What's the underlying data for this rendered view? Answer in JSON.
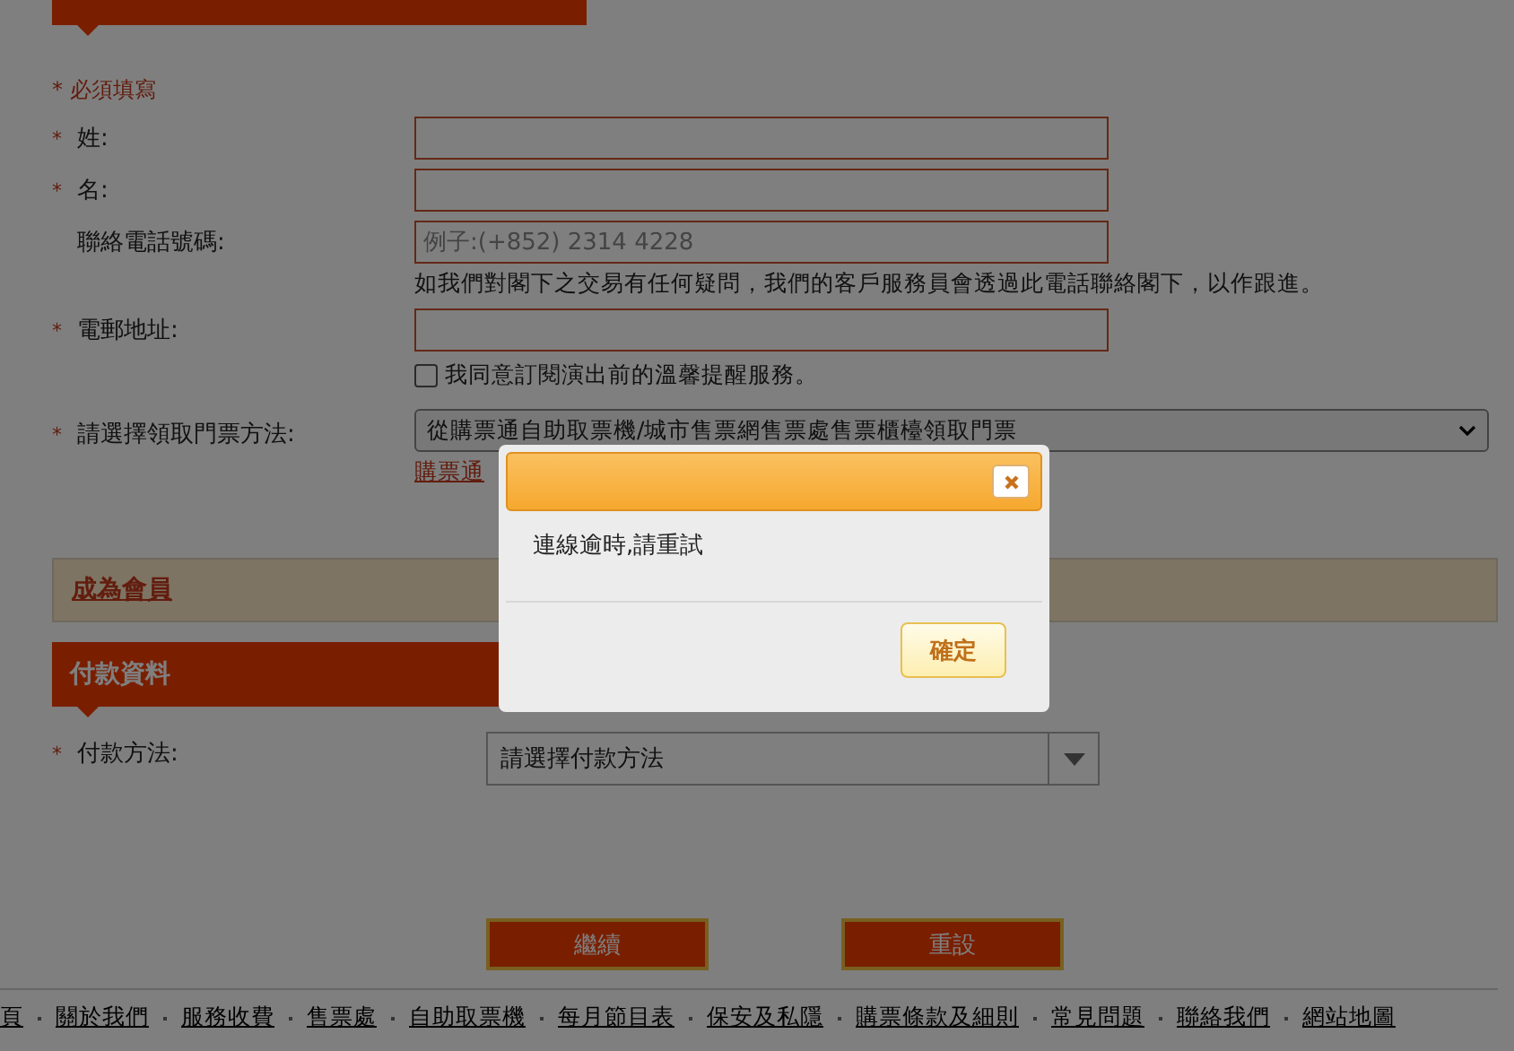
{
  "personal_section": {
    "required_note": "* 必須填寫",
    "fields": [
      {
        "kind": "text",
        "star": "*",
        "label": "姓:"
      },
      {
        "kind": "text",
        "star": "*",
        "label": "名:"
      },
      {
        "kind": "text",
        "label": "聯絡電話號碼:",
        "placeholder": "例子:(+852) 2314 4228",
        "hint": "如我們對閣下之交易有任何疑問，我們的客戶服務員會透過此電話聯絡閣下，以作跟進。"
      },
      {
        "kind": "text",
        "star": "*",
        "label": "電郵地址:"
      },
      {
        "kind": "checkbox",
        "checked": false,
        "label": "我同意訂閱演出前的溫馨提醒服務。"
      },
      {
        "kind": "select",
        "star": "*",
        "label": "請選擇領取門票方法:",
        "value": "從購票通自助取票機/城市售票網售票處售票櫃檯領取門票",
        "link": "購票通"
      }
    ]
  },
  "member_band": {
    "link": "成為會員"
  },
  "payment_section": {
    "title": "付款資料",
    "fields": [
      {
        "kind": "combo",
        "star": "*",
        "label": "付款方法:",
        "value": "請選擇付款方法"
      }
    ]
  },
  "buttons": [
    {
      "label": "繼續"
    },
    {
      "label": "重設"
    }
  ],
  "footer_links": [
    "頁",
    "關於我們",
    "服務收費",
    "售票處",
    "自助取票機",
    "每月節目表",
    "保安及私隱",
    "購票條款及細則",
    "常見問題",
    "聯絡我們",
    "網站地圖"
  ],
  "dialog": {
    "message": "連線逾時,請重試",
    "ok_button": "確定"
  }
}
